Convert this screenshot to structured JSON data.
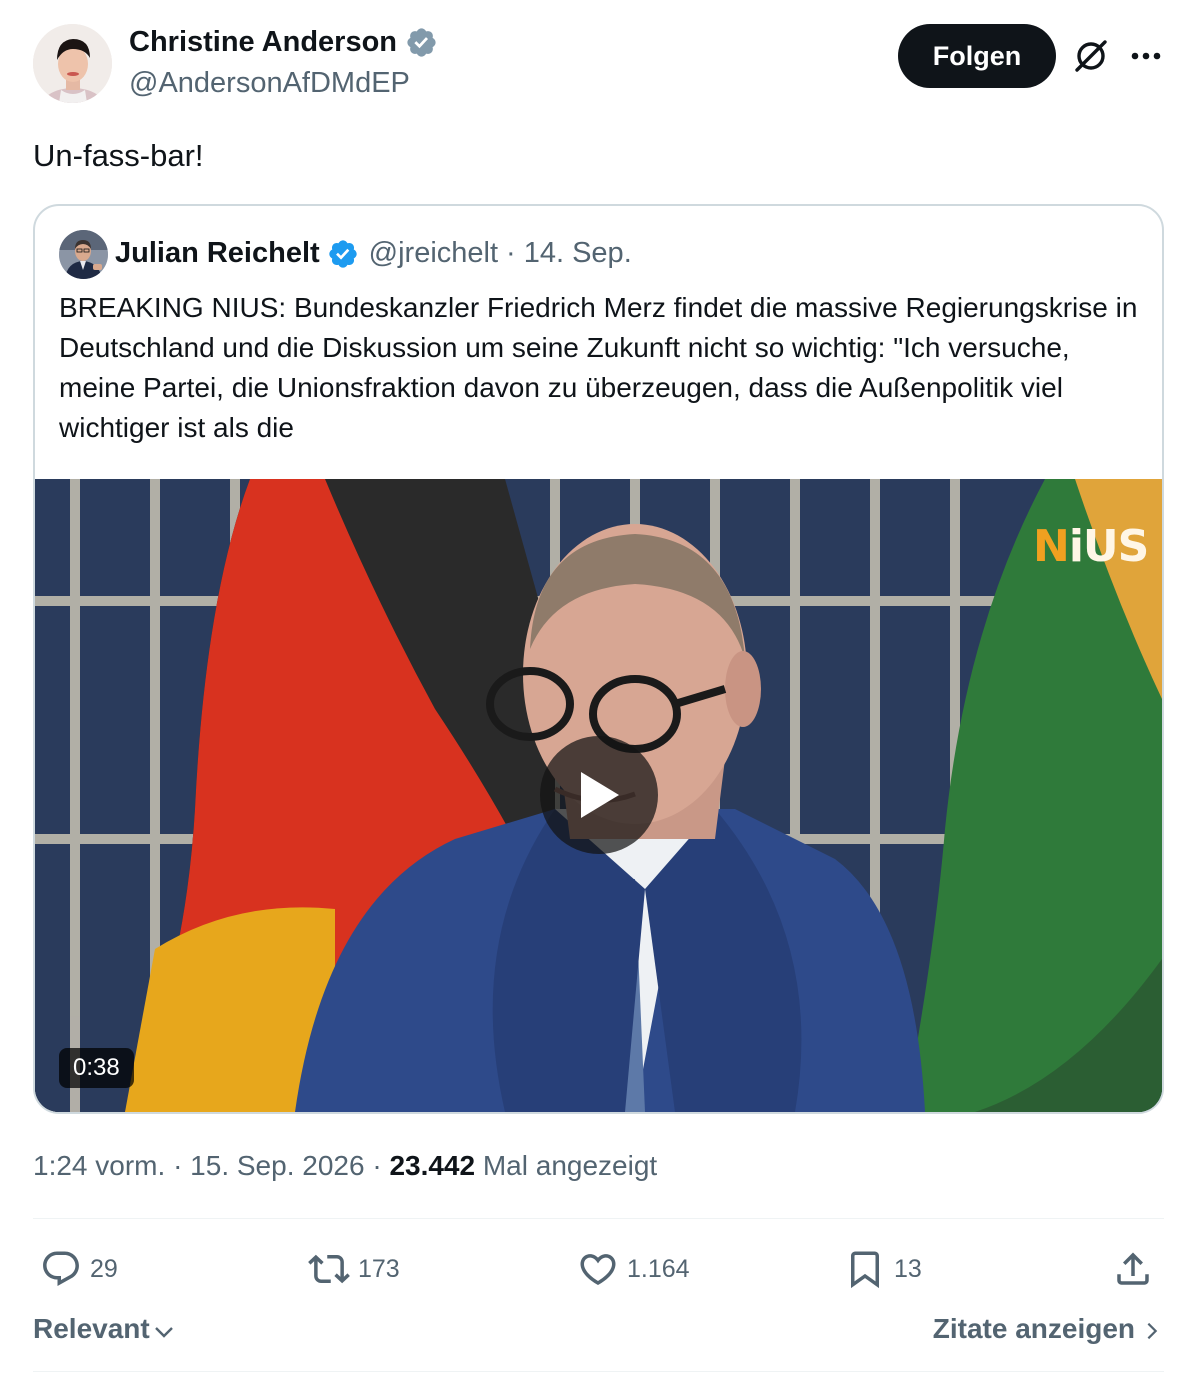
{
  "author": {
    "name": "Christine Anderson",
    "handle": "@AndersonAfDMdEP",
    "verified": true
  },
  "header": {
    "follow_label": "Folgen"
  },
  "tweet": {
    "text": "Un-fass-bar!"
  },
  "quoted": {
    "name": "Julian Reichelt",
    "handle": "@jreichelt",
    "separator": "·",
    "date": "14. Sep.",
    "verified": true,
    "text": "BREAKING NIUS: Bundeskanzler Friedrich Merz findet die massive Regierungskrise in Deutschland und die Diskussion um seine Zukunft nicht so wichtig: \"Ich versuche, meine Partei, die Unionsfraktion davon zu überzeugen, dass die Außenpolitik viel wichtiger ist als die",
    "video": {
      "duration": "0:38",
      "logo_n": "N",
      "logo_rest": "iUS"
    }
  },
  "meta": {
    "time": "1:24 vorm.",
    "separator": "·",
    "date": "15. Sep. 2026",
    "views_count": "23.442",
    "views_label": "Mal angezeigt"
  },
  "actions": {
    "replies": "29",
    "reposts": "173",
    "likes": "1.164",
    "bookmarks": "13"
  },
  "footer": {
    "sort_label": "Relevant",
    "quotes_label": "Zitate anzeigen"
  },
  "colors": {
    "verified_blue": "#1d9bf0",
    "verified_gray": "#829aab",
    "text_primary": "#0f1419",
    "text_secondary": "#536471"
  }
}
